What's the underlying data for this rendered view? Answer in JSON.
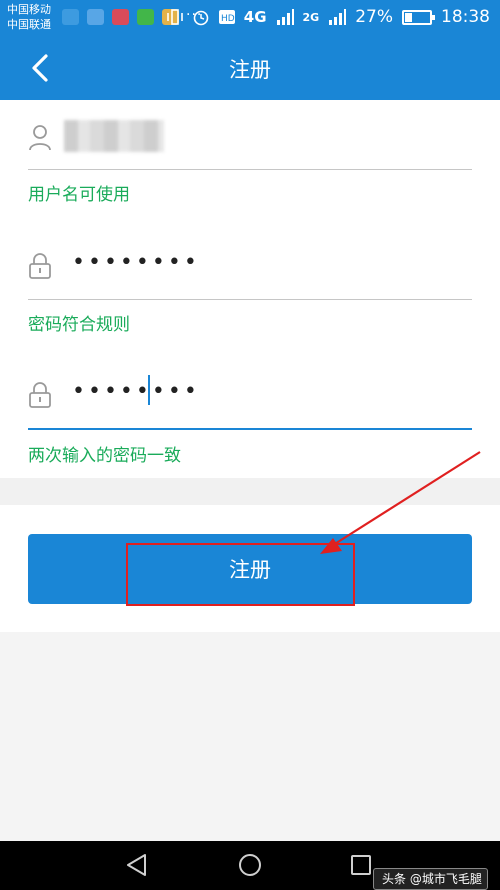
{
  "status_bar": {
    "carrier_1": "中国移动",
    "carrier_2": "中国联通",
    "more": "···",
    "network_4g": "4G",
    "network_2g": "2G",
    "battery": "27%",
    "time": "18:38"
  },
  "app_bar": {
    "back_icon": "chevron-left-icon",
    "title": "注册"
  },
  "form": {
    "username_value": "",
    "username_hint": "用户名可使用",
    "password_value": "••••••••",
    "password_hint": "密码符合规则",
    "confirm_value": "••••••••",
    "confirm_hint": "两次输入的密码一致"
  },
  "submit": {
    "label": "注册"
  },
  "watermark": {
    "text": "头条 @城市飞毛腿"
  },
  "colors": {
    "primary": "#1a86d6",
    "hint_green": "#1aab5a",
    "annotation_red": "#e02020"
  }
}
